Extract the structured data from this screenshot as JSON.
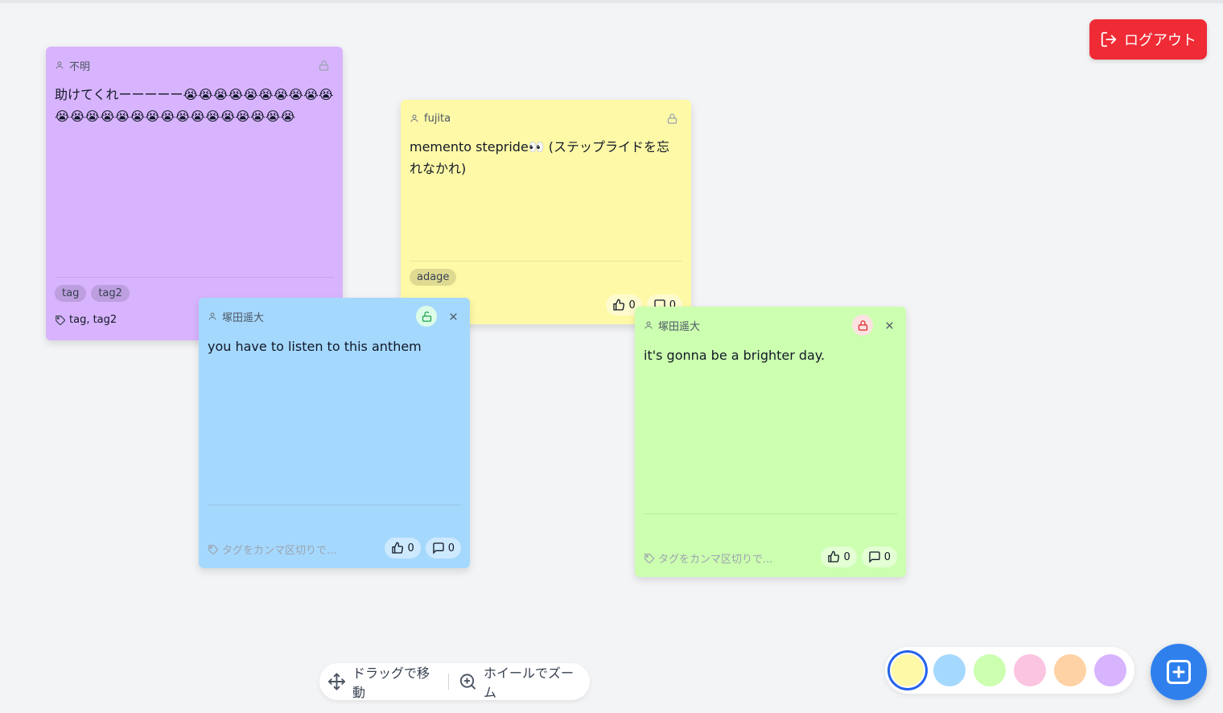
{
  "header": {
    "logout_label": "ログアウト"
  },
  "notes": [
    {
      "author": "不明",
      "color": "#d8b4fe",
      "text": "助けてくれーーーーー😭😭😭😭😭😭😭😭😭😭😭😭😭😭😭😭😭😭😭😭😭😭😭😭😭😭",
      "tags": [
        "tag",
        "tag2"
      ],
      "tag_line": "tag, tag2",
      "locked": true
    },
    {
      "author": "fujita",
      "color": "#fef9a7",
      "text": "memento stepride👀 (ステップライドを忘れなかれ)",
      "tags": [
        "adage"
      ],
      "likes": "0",
      "comments": "0",
      "locked": true
    },
    {
      "author": "塚田遥大",
      "color": "#a5d8fd",
      "text": "you have  to listen to this anthem",
      "tag_placeholder": "タグをカンマ区切りで...",
      "likes": "0",
      "comments": "0",
      "locked": false
    },
    {
      "author": "塚田遥大",
      "color": "#ccffb0",
      "text": "it's gonna be a brighter day.",
      "tag_placeholder": "タグをカンマ区切りで...",
      "likes": "0",
      "comments": "0",
      "locked": true
    }
  ],
  "hints": {
    "drag": "ドラッグで移動",
    "zoom": "ホイールでズーム"
  },
  "palette": {
    "colors": [
      "#fef9a7",
      "#a5d8fd",
      "#ccffb0",
      "#fbc4e1",
      "#fed2a4",
      "#d8b4fe"
    ],
    "selected": "#fef9a7"
  },
  "icons": {
    "logout": "logout-icon",
    "user": "user-icon",
    "lock": "lock-icon",
    "unlock": "unlock-icon",
    "close": "close-icon",
    "tag": "tag-icon",
    "thumbs_up": "thumbs-up-icon",
    "comment": "comment-icon",
    "move": "move-icon",
    "zoom": "zoom-in-icon",
    "add": "add-note-icon"
  }
}
